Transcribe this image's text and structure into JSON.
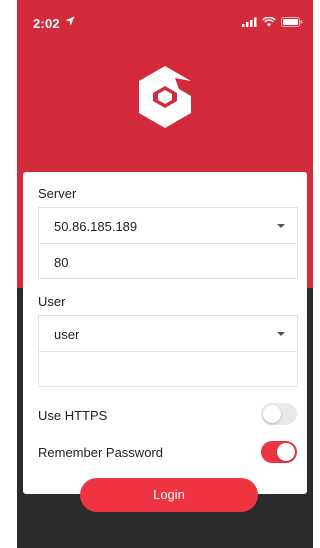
{
  "status_bar": {
    "time": "2:02"
  },
  "colors": {
    "brand_red": "#d42b3c",
    "button_red": "#ef3340",
    "dark_bg": "#2b2b2b"
  },
  "form": {
    "server_label": "Server",
    "server_value": "50.86.185.189",
    "port_value": "80",
    "user_label": "User",
    "user_value": "user",
    "password_value": "",
    "use_https_label": "Use HTTPS",
    "use_https_on": false,
    "remember_password_label": "Remember Password",
    "remember_password_on": true
  },
  "login_button": {
    "label": "Login"
  }
}
